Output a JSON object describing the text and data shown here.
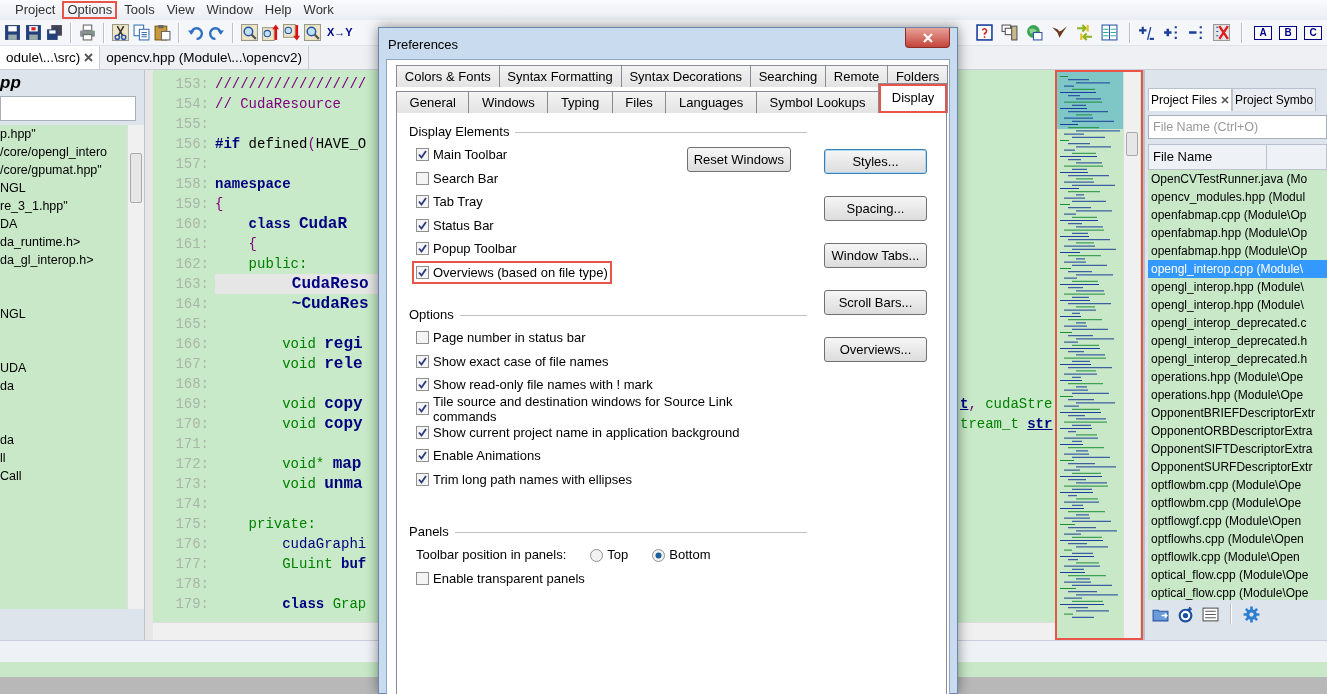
{
  "menu": [
    {
      "label": "Project",
      "highlighted": false
    },
    {
      "label": "Options",
      "highlighted": true
    },
    {
      "label": "Tools",
      "highlighted": false
    },
    {
      "label": "View",
      "highlighted": false
    },
    {
      "label": "Window",
      "highlighted": false
    },
    {
      "label": "Help",
      "highlighted": false
    },
    {
      "label": "Work",
      "highlighted": false
    }
  ],
  "toolbar": {
    "replace_label": "X→Y",
    "bookmark_labels": [
      "A",
      "B",
      "C"
    ]
  },
  "editor_tabs": [
    {
      "label": "odule\\...\\src)",
      "selected": true
    },
    {
      "label": "opencv.hpp (Module\\...\\opencv2)",
      "selected": false
    }
  ],
  "symbol_panel": {
    "title": "pp",
    "groups": [
      [
        "p.hpp\"",
        "/core/opengl_intero",
        "/core/gpumat.hpp\"",
        "NGL",
        "re_3_1.hpp\"",
        "DA",
        "da_runtime.h>",
        "da_gl_interop.h>"
      ],
      [
        "NGL"
      ],
      [
        "UDA",
        "da"
      ],
      [
        "da",
        "ll",
        "Call"
      ]
    ]
  },
  "code_lines": [
    {
      "number": "153:",
      "current": false,
      "code": [
        {
          "text": "//////////////////",
          "kind": "comment"
        }
      ]
    },
    {
      "number": "154:",
      "current": false,
      "code": [
        {
          "text": "// CudaResource",
          "kind": "comment"
        }
      ]
    },
    {
      "number": "155:",
      "current": false
    },
    {
      "number": "156:",
      "current": false,
      "code": [
        {
          "text": "#if",
          "kind": "keyword"
        },
        {
          "text": " defined",
          "kind": "plain"
        },
        {
          "text": "(",
          "kind": "brace"
        },
        {
          "text": "HAVE_O",
          "kind": "plain"
        }
      ]
    },
    {
      "number": "157:",
      "current": false
    },
    {
      "number": "158:",
      "current": false,
      "code": [
        {
          "text": "namespace",
          "kind": "keyword"
        }
      ]
    },
    {
      "number": "159:",
      "current": false,
      "code": [
        {
          "text": "{",
          "kind": "brace"
        }
      ]
    },
    {
      "number": "160:",
      "current": false,
      "code": [
        {
          "text": "    class ",
          "kind": "keyword"
        },
        {
          "text": "CudaR",
          "kind": "ident"
        }
      ]
    },
    {
      "number": "161:",
      "current": false,
      "code": [
        {
          "text": "    {",
          "kind": "brace"
        }
      ]
    },
    {
      "number": "162:",
      "current": false,
      "code": [
        {
          "text": "    public:",
          "kind": "access"
        }
      ]
    },
    {
      "number": "163:",
      "current": true,
      "code": [
        {
          "text": "        CudaReso",
          "kind": "ident"
        }
      ]
    },
    {
      "number": "164:",
      "current": false,
      "code": [
        {
          "text": "        ~CudaRes",
          "kind": "ident"
        }
      ]
    },
    {
      "number": "165:",
      "current": false
    },
    {
      "number": "166:",
      "current": false,
      "code": [
        {
          "text": "        void ",
          "kind": "type"
        },
        {
          "text": "regi",
          "kind": "ident"
        }
      ]
    },
    {
      "number": "167:",
      "current": false,
      "code": [
        {
          "text": "        void ",
          "kind": "type"
        },
        {
          "text": "rele",
          "kind": "ident"
        }
      ]
    },
    {
      "number": "168:",
      "current": false
    },
    {
      "number": "169:",
      "current": false,
      "code": [
        {
          "text": "        void ",
          "kind": "type"
        },
        {
          "text": "copy",
          "kind": "ident"
        }
      ],
      "tail": [
        {
          "text": "t",
          "kind": "param"
        },
        {
          "text": ", ",
          "kind": "brace"
        },
        {
          "text": "cudaStre",
          "kind": "type"
        }
      ]
    },
    {
      "number": "170:",
      "current": false,
      "code": [
        {
          "text": "        void ",
          "kind": "type"
        },
        {
          "text": "copy",
          "kind": "ident"
        }
      ],
      "tail": [
        {
          "text": "tream_t ",
          "kind": "type"
        },
        {
          "text": "str",
          "kind": "param"
        }
      ]
    },
    {
      "number": "171:",
      "current": false
    },
    {
      "number": "172:",
      "current": false,
      "code": [
        {
          "text": "        void* ",
          "kind": "type"
        },
        {
          "text": "map",
          "kind": "ident"
        }
      ]
    },
    {
      "number": "173:",
      "current": false,
      "code": [
        {
          "text": "        void ",
          "kind": "type"
        },
        {
          "text": "unma",
          "kind": "ident"
        }
      ]
    },
    {
      "number": "174:",
      "current": false
    },
    {
      "number": "175:",
      "current": false,
      "code": [
        {
          "text": "    private:",
          "kind": "access"
        }
      ]
    },
    {
      "number": "176:",
      "current": false,
      "code": [
        {
          "text": "        cudaGraphi",
          "kind": "plainnavy"
        }
      ]
    },
    {
      "number": "177:",
      "current": false,
      "code": [
        {
          "text": "        GLuint ",
          "kind": "type"
        },
        {
          "text": "buf",
          "kind": "member"
        }
      ]
    },
    {
      "number": "178:",
      "current": false
    },
    {
      "number": "179:",
      "current": false,
      "code": [
        {
          "text": "        class ",
          "kind": "keyword"
        },
        {
          "text": "Grap",
          "kind": "type"
        }
      ]
    }
  ],
  "overview": {
    "highlighted": true
  },
  "project_panel": {
    "tabs": [
      {
        "label": "Project Files",
        "selected": true
      },
      {
        "label": "Project Symbo",
        "selected": false
      }
    ],
    "search": {
      "placeholder": "File Name (Ctrl+O)"
    },
    "columns": [
      "File Name"
    ],
    "rows": [
      {
        "name": "OpenCVTestRunner.java (Mo",
        "selected": false
      },
      {
        "name": "opencv_modules.hpp (Modul",
        "selected": false
      },
      {
        "name": "openfabmap.cpp (Module\\Op",
        "selected": false
      },
      {
        "name": "openfabmap.hpp (Module\\Op",
        "selected": false
      },
      {
        "name": "openfabmap.hpp (Module\\Op",
        "selected": false
      },
      {
        "name": "opengl_interop.cpp (Module\\",
        "selected": true
      },
      {
        "name": "opengl_interop.hpp (Module\\",
        "selected": false
      },
      {
        "name": "opengl_interop.hpp (Module\\",
        "selected": false
      },
      {
        "name": "opengl_interop_deprecated.c",
        "selected": false
      },
      {
        "name": "opengl_interop_deprecated.h",
        "selected": false
      },
      {
        "name": "opengl_interop_deprecated.h",
        "selected": false
      },
      {
        "name": "operations.hpp (Module\\Ope",
        "selected": false
      },
      {
        "name": "operations.hpp (Module\\Ope",
        "selected": false
      },
      {
        "name": "OpponentBRIEFDescriptorExtr",
        "selected": false
      },
      {
        "name": "OpponentORBDescriptorExtra",
        "selected": false
      },
      {
        "name": "OpponentSIFTDescriptorExtra",
        "selected": false
      },
      {
        "name": "OpponentSURFDescriptorExtr",
        "selected": false
      },
      {
        "name": "optflowbm.cpp (Module\\Ope",
        "selected": false
      },
      {
        "name": "optflowbm.cpp (Module\\Ope",
        "selected": false
      },
      {
        "name": "optflowgf.cpp (Module\\Open",
        "selected": false
      },
      {
        "name": "optflowhs.cpp (Module\\Open",
        "selected": false
      },
      {
        "name": "optflowlk.cpp (Module\\Open",
        "selected": false
      },
      {
        "name": "optical_flow.cpp (Module\\Ope",
        "selected": false
      },
      {
        "name": "optical_flow.cpp (Module\\Ope",
        "selected": false
      }
    ]
  },
  "dialog": {
    "title": "Preferences",
    "tab_rows": [
      [
        {
          "label": "Colors & Fonts",
          "selected": false,
          "highlighted": false
        },
        {
          "label": "Syntax Formatting",
          "selected": false,
          "highlighted": false
        },
        {
          "label": "Syntax Decorations",
          "selected": false,
          "highlighted": false
        },
        {
          "label": "Searching",
          "selected": false,
          "highlighted": false
        },
        {
          "label": "Remote",
          "selected": false,
          "highlighted": false
        },
        {
          "label": "Folders",
          "selected": false,
          "highlighted": false
        }
      ],
      [
        {
          "label": "General",
          "selected": false,
          "highlighted": false
        },
        {
          "label": "Windows",
          "selected": false,
          "highlighted": false
        },
        {
          "label": "Typing",
          "selected": false,
          "highlighted": false
        },
        {
          "label": "Files",
          "selected": false,
          "highlighted": false
        },
        {
          "label": "Languages",
          "selected": false,
          "highlighted": false
        },
        {
          "label": "Symbol Lookups",
          "selected": false,
          "highlighted": false
        },
        {
          "label": "Display",
          "selected": true,
          "highlighted": true
        }
      ]
    ],
    "display_elements": {
      "title": "Display Elements",
      "reset_button": "Reset Windows",
      "checkboxes": [
        {
          "label": "Main Toolbar",
          "checked": true,
          "highlighted": false
        },
        {
          "label": "Search Bar",
          "checked": false,
          "highlighted": false
        },
        {
          "label": "Tab Tray",
          "checked": true,
          "highlighted": false
        },
        {
          "label": "Status Bar",
          "checked": true,
          "highlighted": false
        },
        {
          "label": "Popup Toolbar",
          "checked": true,
          "highlighted": false
        },
        {
          "label": "Overviews (based on file type)",
          "checked": true,
          "highlighted": true
        }
      ]
    },
    "options": {
      "title": "Options",
      "checkboxes": [
        {
          "label": "Page number in status bar",
          "checked": false,
          "highlighted": false
        },
        {
          "label": "Show exact case of file names",
          "checked": true,
          "highlighted": false
        },
        {
          "label": "Show read-only file names with ! mark",
          "checked": true,
          "highlighted": false
        },
        {
          "label": "Tile source and destination windows for Source Link commands",
          "checked": true,
          "highlighted": false
        },
        {
          "label": "Show current project name in application background",
          "checked": true,
          "highlighted": false
        },
        {
          "label": "Enable Animations",
          "checked": true,
          "highlighted": false
        },
        {
          "label": "Trim long path names with ellipses",
          "checked": true,
          "highlighted": false
        }
      ]
    },
    "panels": {
      "title": "Panels",
      "toolbar_position": {
        "label": "Toolbar position in panels:",
        "options": [
          {
            "label": "Top",
            "selected": false
          },
          {
            "label": "Bottom",
            "selected": true
          }
        ]
      },
      "checkboxes": [
        {
          "label": "Enable transparent panels",
          "checked": false,
          "highlighted": false
        }
      ]
    },
    "side_buttons": [
      {
        "label": "Styles...",
        "focused": true
      },
      {
        "label": "Spacing...",
        "focused": false
      },
      {
        "label": "Window Tabs...",
        "focused": false
      },
      {
        "label": "Scroll Bars...",
        "focused": false
      },
      {
        "label": "Overviews...",
        "focused": false
      }
    ]
  }
}
